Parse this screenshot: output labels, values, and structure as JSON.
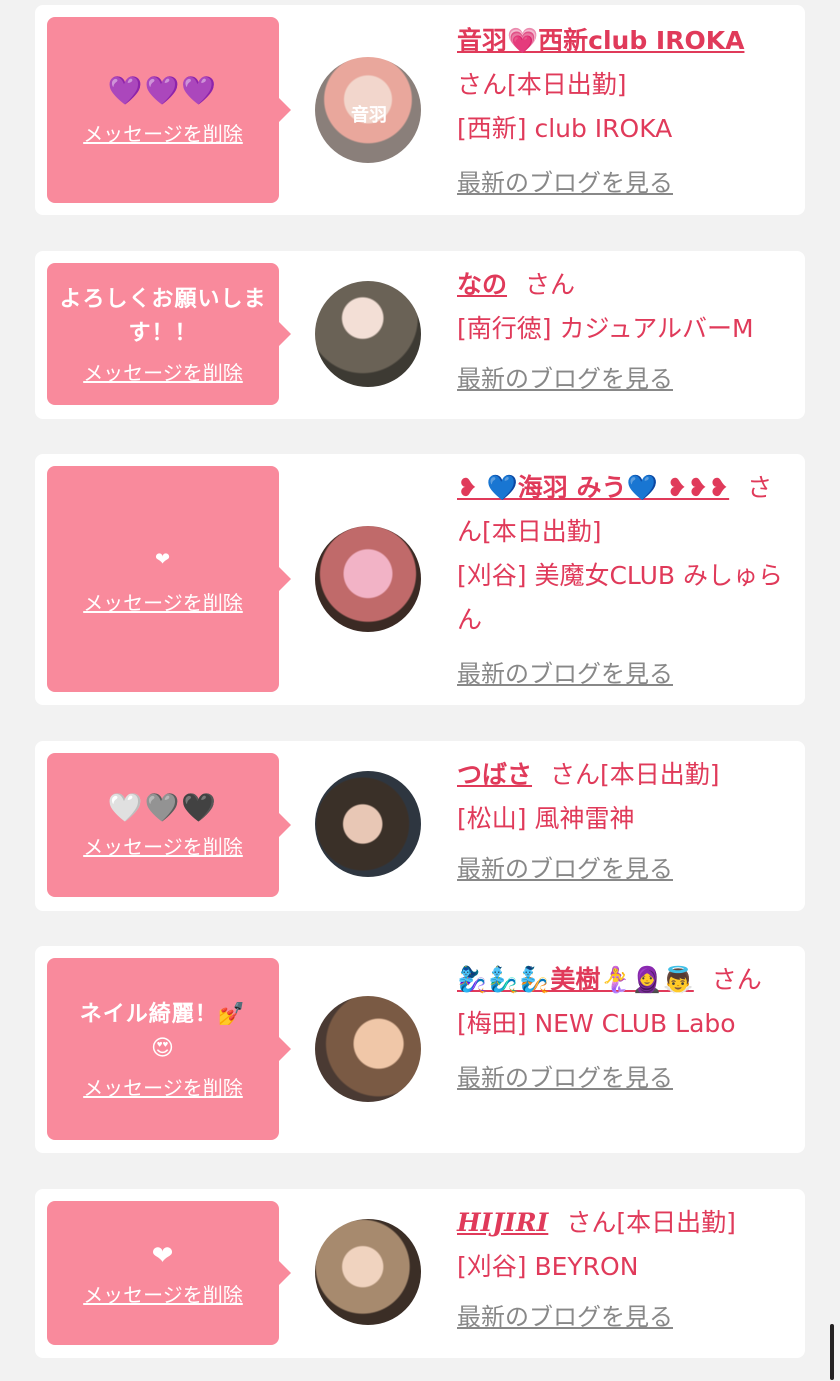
{
  "delete_label": "メッセージを削除",
  "blog_label": "最新のブログを見る",
  "san_label": "さん",
  "cards": [
    {
      "message": "💜💜💜",
      "name": "音羽💗西新club IROKA",
      "on_duty": "[本日出勤]",
      "shop": "[西新] club IROKA",
      "avatar_icon": "avatar-photo",
      "avatar_overlay": "音羽"
    },
    {
      "message": "よろしくお願いします！！",
      "name": "なの",
      "on_duty": "",
      "shop": "[南行徳] カジュアルバーM",
      "avatar_icon": "avatar-photo"
    },
    {
      "message": "❤",
      "name": "❥ 💙海羽 みう💙 ❥❥❥",
      "on_duty": "[本日出勤]",
      "shop": "[刈谷] 美魔女CLUB みしゅらん",
      "avatar_icon": "avatar-photo"
    },
    {
      "message": "🤍🩶🖤",
      "name": "つばさ",
      "on_duty": "[本日出勤]",
      "shop": "[松山] 風神雷神",
      "avatar_icon": "avatar-photo"
    },
    {
      "message": "ネイル綺麗！💅😍",
      "name": "🧞‍♀️🧞‍♂️🧞美樹🧜‍♀️🧕👼",
      "on_duty": "",
      "shop": "[梅田] NEW CLUB Labo",
      "avatar_icon": "avatar-photo"
    },
    {
      "message": "❤",
      "name": "HIJIRI",
      "on_duty": "[本日出勤]",
      "shop": "[刈谷] BEYRON",
      "avatar_icon": "avatar-photo"
    }
  ]
}
